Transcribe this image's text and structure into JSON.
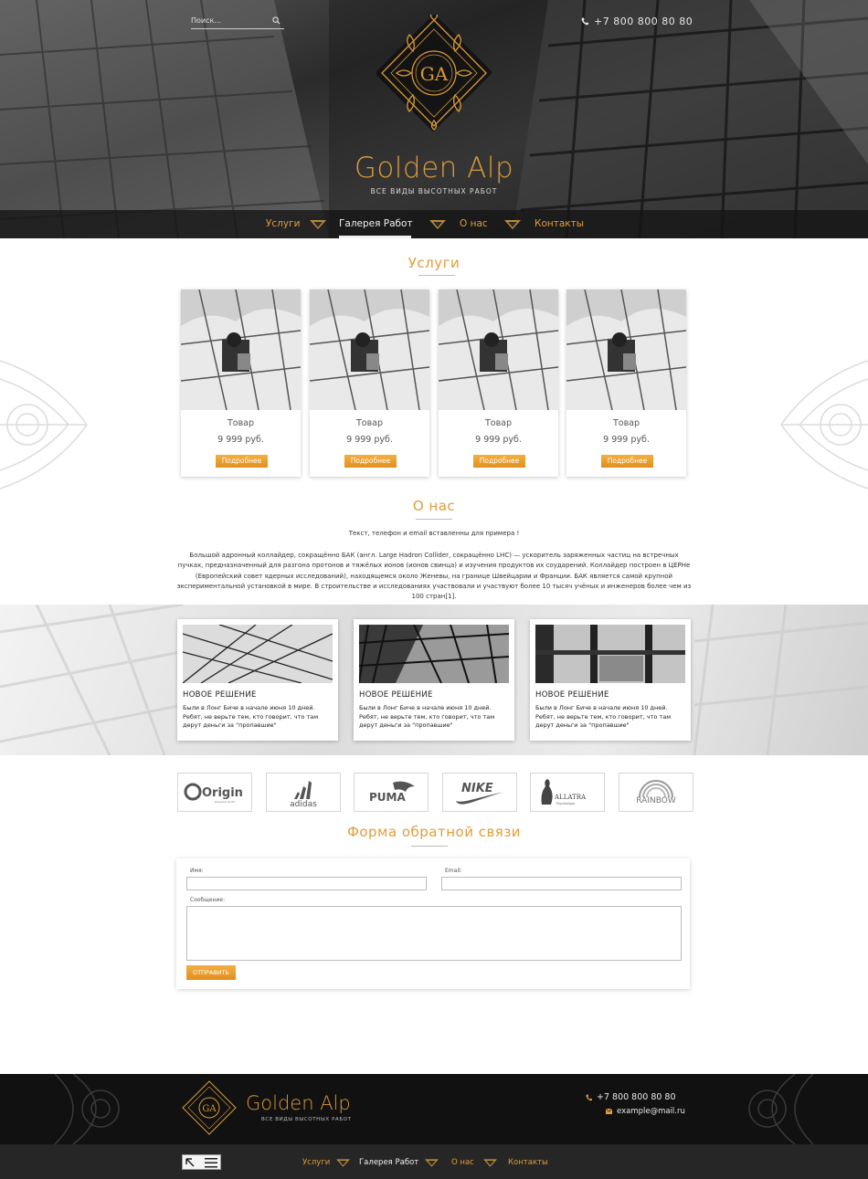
{
  "header": {
    "search_placeholder": "Поиск...",
    "phone": "+7 800 800 80 80",
    "brand_title": "Golden Alp",
    "brand_subtitle": "ВСЕ ВИДЫ ВЫСОТНЫХ РАБОТ",
    "emblem_letters": "GA"
  },
  "nav": {
    "items": [
      "Услуги",
      "Галерея Работ",
      "О нас",
      "Контакты"
    ],
    "active": "Галерея Работ"
  },
  "services": {
    "title": "Услуги",
    "cards": [
      {
        "name": "Товар",
        "price": "9 999 руб.",
        "button": "Подробнее"
      },
      {
        "name": "Товар",
        "price": "9 999 руб.",
        "button": "Подробнее"
      },
      {
        "name": "Товар",
        "price": "9 999 руб.",
        "button": "Подробнее"
      },
      {
        "name": "Товар",
        "price": "9 999 руб.",
        "button": "Подробнее"
      }
    ]
  },
  "about": {
    "title": "О нас",
    "lead": "Текст, телефон и email вставленны для примера !",
    "text": "Большой адронный коллайдер, сокращённо БАК (англ. Large Hadron Collider, сокращённо LHC) — ускоритель заряженных частиц на встречных пучках, предназначенный для разгона протонов и тяжёлых ионов (ионов свинца) и изучения продуктов их соударений. Коллайдер построен в ЦЕРНе (Европейский совет ядерных исследований), находящемся около Женевы, на границе Швейцарии и Франции. БАК является самой крупной экспериментальной установкой в мире. В строительстве и исследованиях участвовали и участвуют более 10 тысяч учёных и инженеров более чем из 100 стран[1]."
  },
  "news": [
    {
      "title": "НОВОЕ РЕШЕНИЕ",
      "text": "Были в Лонг Биче в начале июня 10 дней. Ребят, не верьте тем, кто говорит, что там дерут деньги за \"пропавшие\""
    },
    {
      "title": "НОВОЕ РЕШЕНИЕ",
      "text": "Были в Лонг Биче в начале июня 10 дней. Ребят, не верьте тем, кто говорит, что там дерут деньги за \"пропавшие\""
    },
    {
      "title": "НОВОЕ РЕШЕНИЕ",
      "text": "Были в Лонг Биче в начале июня 10 дней. Ребят, не верьте тем, кто говорит, что там дерут деньги за \"пропавшие\""
    }
  ],
  "brands": {
    "origin": "Origin",
    "origin_sub": "Powered by EA",
    "adidas": "adidas",
    "puma": "PUMA",
    "nike": "NIKE",
    "allatra": "ALLATRA",
    "allatra_sub": "Psychologic",
    "rainbow": "RAINBOW"
  },
  "form": {
    "title": "Форма обратной связи",
    "name_label": "Имя:",
    "email_label": "Email:",
    "message_label": "Сообщение:",
    "submit": "ОТПРАВИТЬ"
  },
  "footer": {
    "brand_title": "Golden Alp",
    "brand_subtitle": "ВСЕ ВИДЫ ВЫСОТНЫХ РАБОТ",
    "phone": "+7 800 800 80 80",
    "email": "example@mail.ru",
    "nav": [
      "Услуги",
      "Галерея Работ",
      "О нас",
      "Контакты"
    ]
  },
  "colors": {
    "accent": "#e09d3b",
    "gold": "#d89a3a",
    "dark": "#111111"
  }
}
